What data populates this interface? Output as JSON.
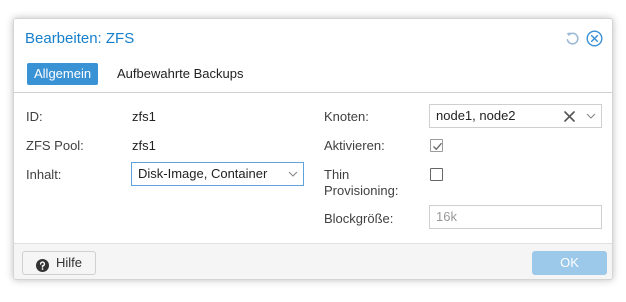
{
  "dialog": {
    "title": "Bearbeiten: ZFS",
    "tools": {
      "reset_icon": "reset-icon",
      "close_icon": "close-circle-icon"
    }
  },
  "tabs": [
    {
      "label": "Allgemein",
      "active": true
    },
    {
      "label": "Aufbewahrte Backups",
      "active": false
    }
  ],
  "form": {
    "id": {
      "label": "ID:",
      "value": "zfs1"
    },
    "zfs_pool": {
      "label": "ZFS Pool:",
      "value": "zfs1"
    },
    "content": {
      "label": "Inhalt:",
      "value": "Disk-Image, Container"
    },
    "nodes": {
      "label": "Knoten:",
      "value": "node1, node2"
    },
    "enable": {
      "label": "Aktivieren:",
      "checked": true
    },
    "thin": {
      "label_line1": "Thin",
      "label_line2": "Provisioning:",
      "checked": false
    },
    "blocksize": {
      "label": "Blockgröße:",
      "placeholder": "16k"
    }
  },
  "footer": {
    "help_label": "Hilfe",
    "ok_label": "OK"
  },
  "colors": {
    "accent": "#157fcc",
    "active_tab": "#3892d4",
    "ok_disabled": "#9cc8ea"
  }
}
